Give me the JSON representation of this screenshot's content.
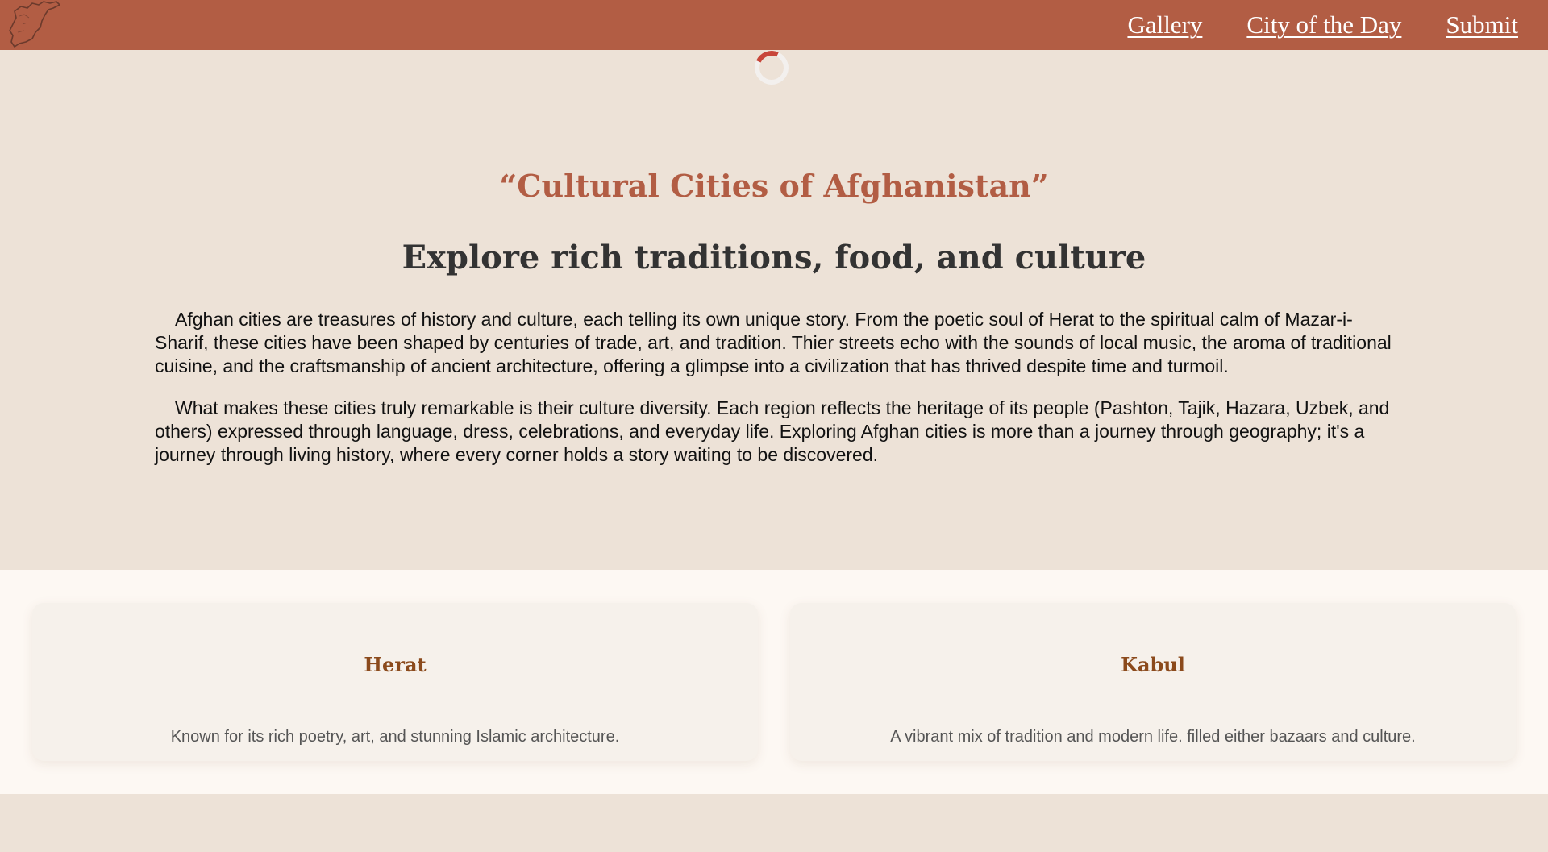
{
  "nav": {
    "links": [
      {
        "label": "Gallery"
      },
      {
        "label": "City of the Day"
      },
      {
        "label": "Submit"
      }
    ]
  },
  "hero": {
    "title": "“Cultural Cities of Afghanistan”",
    "subtitle": "Explore rich traditions, food, and culture",
    "paragraphs": [
      "Afghan cities are treasures of history and culture, each telling its own unique story. From the poetic soul of Herat to the spiritual calm of Mazar-i-Sharif, these cities have been shaped by centuries of trade, art, and tradition. Thier streets echo with the sounds of local music, the aroma of traditional cuisine, and the craftsmanship of ancient architecture, offering a glimpse into a civilization that has thrived despite time and turmoil.",
      "What makes these cities truly remarkable is their culture diversity. Each region reflects the heritage of its people (Pashton, Tajik, Hazara, Uzbek, and others) expressed through language, dress, celebrations, and everyday life. Exploring Afghan cities is more than a journey through geography; it's a journey through living history, where every corner holds a story waiting to be discovered."
    ]
  },
  "cards": [
    {
      "name": "Herat",
      "description": "Known for its rich poetry, art, and stunning Islamic architecture."
    },
    {
      "name": "Kabul",
      "description": "A vibrant mix of tradition and modern life. filled either bazaars and culture."
    }
  ],
  "colors": {
    "header": "#b25d44",
    "background": "#ede2d7",
    "title": "#b25d44",
    "card_title": "#8b4a1c"
  },
  "icons": {
    "logo": "afghanistan-map-outline-icon",
    "loading": "loading-spinner-icon"
  }
}
